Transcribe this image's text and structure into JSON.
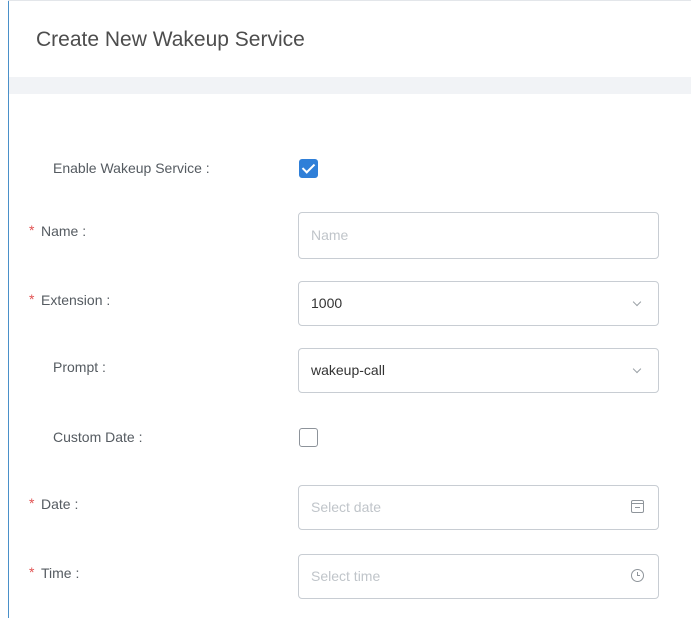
{
  "dialog": {
    "title": "Create New Wakeup Service"
  },
  "form": {
    "enable": {
      "label": "Enable Wakeup Service :",
      "checked": true
    },
    "name": {
      "label": "Name :",
      "required_mark": "*",
      "placeholder": "Name",
      "value": ""
    },
    "extension": {
      "label": "Extension :",
      "required_mark": "*",
      "value": "1000",
      "icon": "chevron-down-icon"
    },
    "prompt": {
      "label": "Prompt :",
      "value": "wakeup-call",
      "icon": "chevron-down-icon"
    },
    "custom_date": {
      "label": "Custom Date :",
      "checked": false
    },
    "date": {
      "label": "Date :",
      "required_mark": "*",
      "placeholder": "Select date",
      "icon": "calendar-icon"
    },
    "time": {
      "label": "Time :",
      "required_mark": "*",
      "placeholder": "Select time",
      "icon": "clock-icon"
    }
  },
  "colors": {
    "accent": "#2f7fd8",
    "required": "#e15252",
    "panel_border": "#4a90c9",
    "header_band": "#f1f3f6"
  }
}
